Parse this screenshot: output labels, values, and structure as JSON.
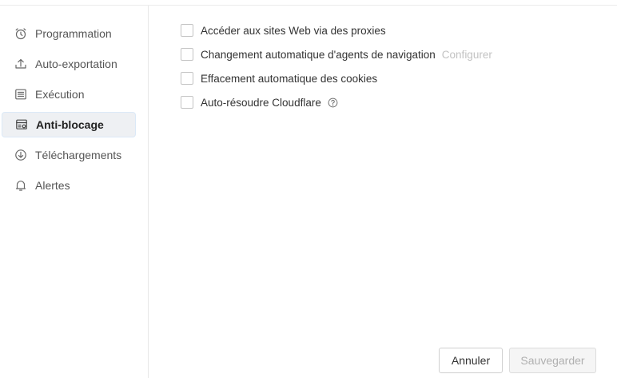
{
  "sidebar": {
    "items": [
      {
        "label": "Programmation",
        "icon": "alarm-clock-icon",
        "active": false
      },
      {
        "label": "Auto-exportation",
        "icon": "upload-icon",
        "active": false
      },
      {
        "label": "Exécution",
        "icon": "list-icon",
        "active": false
      },
      {
        "label": "Anti-blocage",
        "icon": "browser-shield-icon",
        "active": true
      },
      {
        "label": "Téléchargements",
        "icon": "download-circle-icon",
        "active": false
      },
      {
        "label": "Alertes",
        "icon": "bell-icon",
        "active": false
      }
    ]
  },
  "options": [
    {
      "label": "Accéder aux sites Web via des proxies",
      "checked": false
    },
    {
      "label": "Changement automatique d'agents de navigation",
      "checked": false,
      "link": "Configurer"
    },
    {
      "label": "Effacement automatique des cookies",
      "checked": false
    },
    {
      "label": "Auto-résoudre Cloudflare",
      "checked": false,
      "help_icon": "question-circle-icon"
    }
  ],
  "buttons": {
    "cancel": "Annuler",
    "save": "Sauvegarder",
    "save_disabled": true
  },
  "colors": {
    "active_bg": "#eef0f3",
    "active_border": "#dbe9f7",
    "link_muted": "#c2c2c2"
  }
}
